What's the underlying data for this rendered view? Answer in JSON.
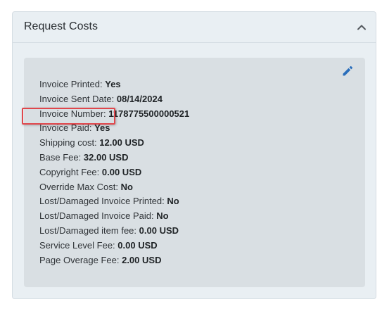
{
  "panel": {
    "title": "Request Costs"
  },
  "icons": {
    "collapse": "chevron-up-icon",
    "edit": "pencil-icon"
  },
  "colors": {
    "edit_icon": "#2a6ebb",
    "highlight_border": "#e0474c"
  },
  "fields": [
    {
      "label": "Invoice Printed:",
      "value": "Yes"
    },
    {
      "label": "Invoice Sent Date:",
      "value": "08/14/2024"
    },
    {
      "label": "Invoice Number:",
      "value": "1178775500000521"
    },
    {
      "label": "Invoice Paid:",
      "value": "Yes"
    },
    {
      "label": "Shipping cost:",
      "value": "12.00 USD"
    },
    {
      "label": "Base Fee:",
      "value": "32.00 USD"
    },
    {
      "label": "Copyright Fee:",
      "value": "0.00 USD"
    },
    {
      "label": "Override Max Cost:",
      "value": "No"
    },
    {
      "label": "Lost/Damaged Invoice Printed:",
      "value": "No"
    },
    {
      "label": "Lost/Damaged Invoice Paid:",
      "value": "No"
    },
    {
      "label": "Lost/Damaged item fee:",
      "value": "0.00 USD"
    },
    {
      "label": "Service Level Fee:",
      "value": "0.00 USD"
    },
    {
      "label": "Page Overage Fee:",
      "value": "2.00 USD"
    }
  ]
}
